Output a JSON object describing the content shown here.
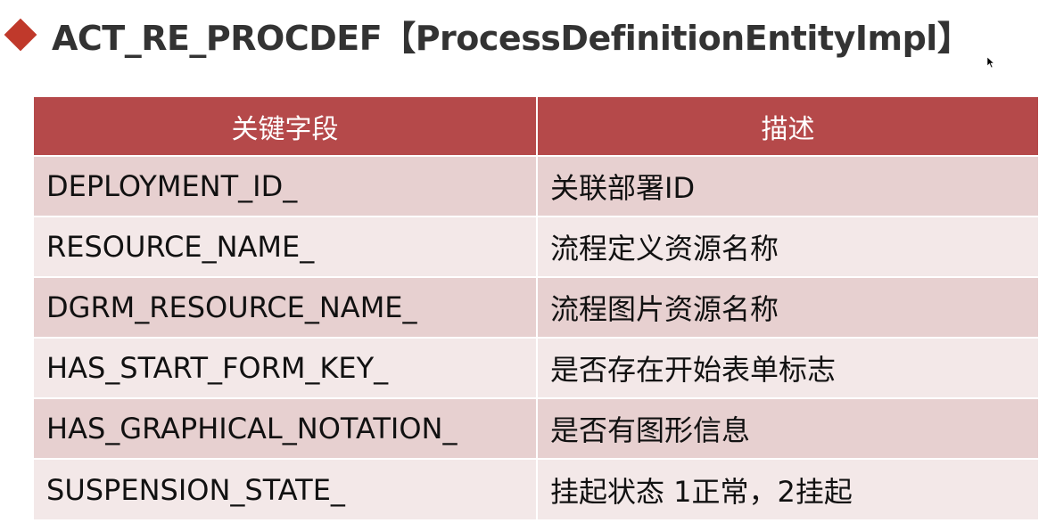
{
  "title": "ACT_RE_PROCDEF【ProcessDefinitionEntityImpl】",
  "colors": {
    "accent": "#c0392b",
    "header_bg": "#b5494a",
    "row_odd_bg": "#e7d0d0",
    "row_even_bg": "#f3e8e8"
  },
  "table": {
    "headers": [
      "关键字段",
      "描述"
    ],
    "rows": [
      {
        "field": "DEPLOYMENT_ID_",
        "desc": "关联部署ID"
      },
      {
        "field": "RESOURCE_NAME_",
        "desc": "流程定义资源名称"
      },
      {
        "field": "DGRM_RESOURCE_NAME_",
        "desc": "流程图片资源名称"
      },
      {
        "field": "HAS_START_FORM_KEY_",
        "desc": "是否存在开始表单标志"
      },
      {
        "field": "HAS_GRAPHICAL_NOTATION_",
        "desc": "是否有图形信息"
      },
      {
        "field": "SUSPENSION_STATE_",
        "desc": "挂起状态 1正常，2挂起"
      }
    ]
  }
}
